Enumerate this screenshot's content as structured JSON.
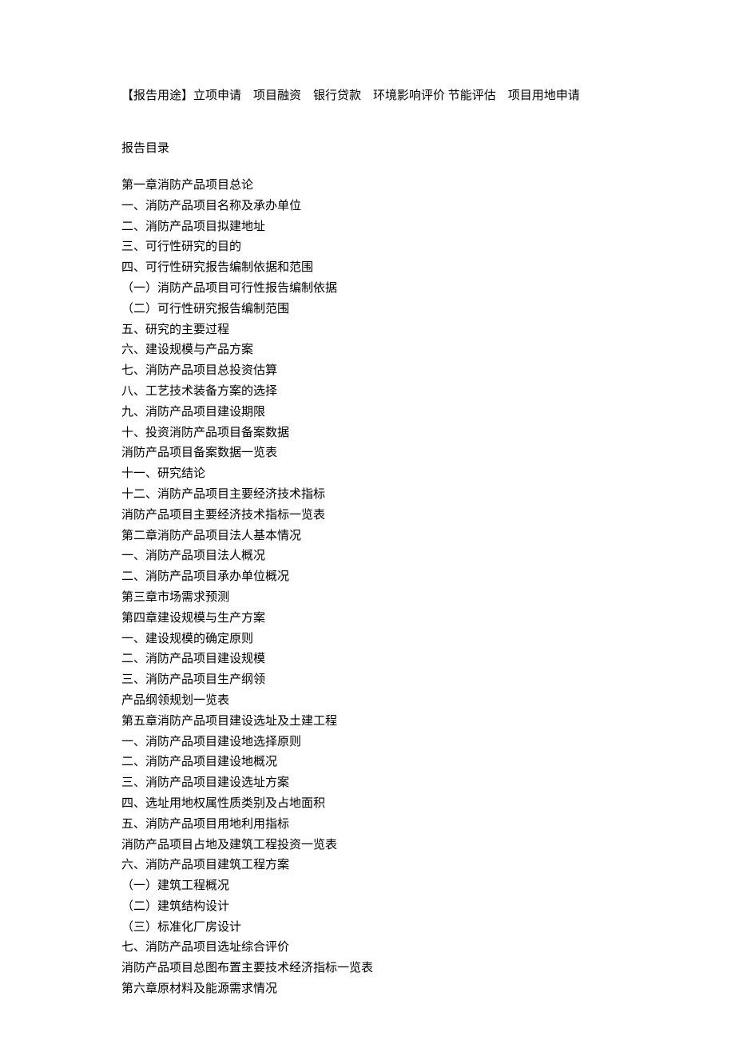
{
  "usage": {
    "prefix": "【报告用途】",
    "items_joined": "立项申请　项目融资　银行贷款　环境影响评价  节能评估　项目用地申请"
  },
  "section_header": "报告目录",
  "toc": [
    "第一章消防产品项目总论",
    "一、消防产品项目名称及承办单位",
    "二、消防产品项目拟建地址",
    "三、可行性研究的目的",
    "四、可行性研究报告编制依据和范围",
    "（一）消防产品项目可行性报告编制依据",
    "（二）可行性研究报告编制范围",
    "五、研究的主要过程",
    "六、建设规模与产品方案",
    "七、消防产品项目总投资估算",
    "八、工艺技术装备方案的选择",
    "九、消防产品项目建设期限",
    "十、投资消防产品项目备案数据",
    "消防产品项目备案数据一览表",
    "十一、研究结论",
    "十二、消防产品项目主要经济技术指标",
    "消防产品项目主要经济技术指标一览表",
    "第二章消防产品项目法人基本情况",
    "一、消防产品项目法人概况",
    "二、消防产品项目承办单位概况",
    "第三章市场需求预测",
    "第四章建设规模与生产方案",
    "一、建设规模的确定原则",
    "二、消防产品项目建设规模",
    "三、消防产品项目生产纲领",
    "产品纲领规划一览表",
    "第五章消防产品项目建设选址及土建工程",
    "一、消防产品项目建设地选择原则",
    "二、消防产品项目建设地概况",
    "三、消防产品项目建设选址方案",
    "四、选址用地权属性质类别及占地面积",
    "五、消防产品项目用地利用指标",
    "消防产品项目占地及建筑工程投资一览表",
    "六、消防产品项目建筑工程方案",
    "（一）建筑工程概况",
    "（二）建筑结构设计",
    "（三）标准化厂房设计",
    "七、消防产品项目选址综合评价",
    "消防产品项目总图布置主要技术经济指标一览表",
    "第六章原材料及能源需求情况"
  ]
}
